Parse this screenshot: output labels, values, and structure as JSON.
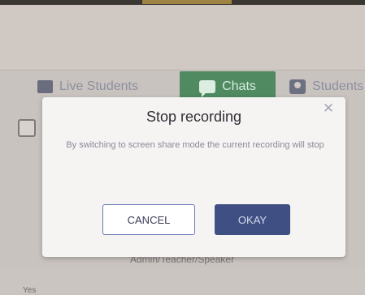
{
  "tabs": [
    {
      "label": "Live Students",
      "icon": "square-icon"
    },
    {
      "label": "Chats",
      "icon": "chat-icon"
    },
    {
      "label": "Students",
      "icon": "person-icon"
    }
  ],
  "modal": {
    "title": "Stop recording",
    "message": "By switching to screen share mode the current recording will stop",
    "cancel_label": "CANCEL",
    "okay_label": "OKAY",
    "close_glyph": "✕"
  },
  "background": {
    "under_text": "Admin/Teacher/Speaker",
    "bottom_label": "Yes"
  },
  "colors": {
    "accent_green": "#4f8a61",
    "okay_button": "#3f4f84",
    "cancel_border": "#6b7ab0"
  }
}
